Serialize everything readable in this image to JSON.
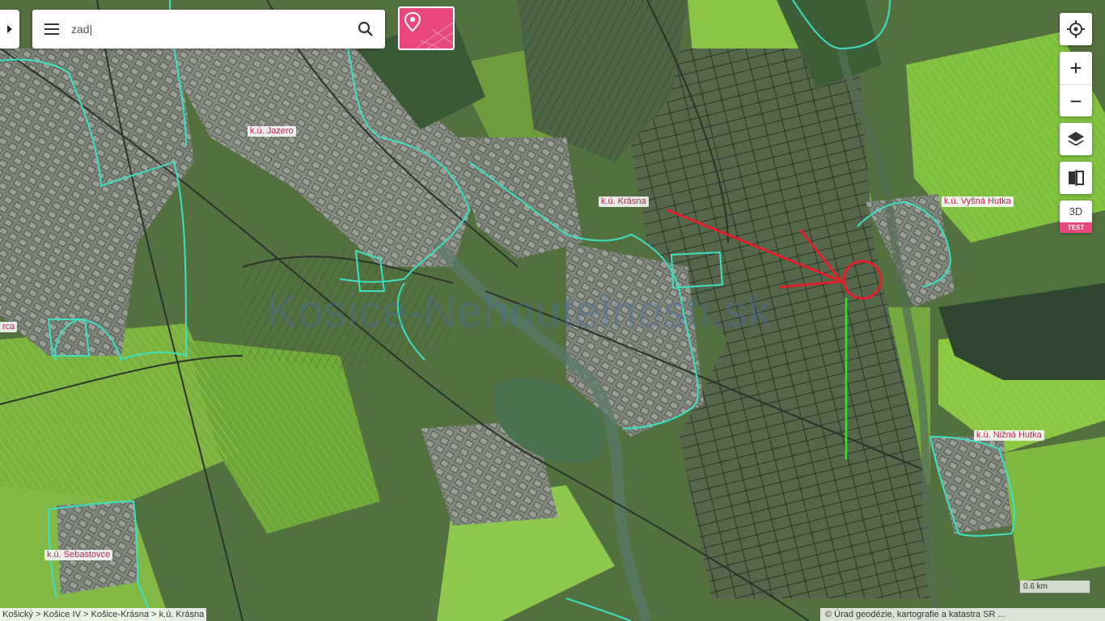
{
  "search": {
    "value": "zad|",
    "placeholder": ""
  },
  "icons": {
    "panel_toggle": "caret-right-icon",
    "menu": "hamburger-menu-icon",
    "search": "search-icon",
    "logo": "map-pin-icon",
    "locate": "crosshair-icon",
    "zoom_in": "plus-icon",
    "zoom_out": "minus-icon",
    "layers": "layers-icon",
    "compare": "split-view-icon"
  },
  "controls": {
    "zoom_in": "+",
    "zoom_out": "−",
    "view_3d": "3D",
    "view_3d_badge": "TEST"
  },
  "map": {
    "labels": {
      "jazero": "k.ú. Jazero",
      "krasna": "k.ú. Krásna",
      "vysna_hutka": "k.ú. Vyšná Hutka",
      "nizna_hutka": "k.ú. Nižná Hutka",
      "sebastovce": "k.ú. Šebastovce",
      "cut_left": "rca"
    },
    "watermark": "Kosice-Nehnutelnosti.sk",
    "scale": "0.6 km",
    "colors": {
      "cadastral_boundary": "#3ee0c0",
      "annotation": "#e02028",
      "highlight_line": "#22ee33",
      "label_text": "#c0235c",
      "brand": "#e8477f"
    }
  },
  "breadcrumb": [
    "Košický",
    "Košice IV",
    "Košice-Krásna",
    "k.ú. Krásna"
  ],
  "attribution": "© Úrad geodézie, kartografie a katastra SR ..."
}
